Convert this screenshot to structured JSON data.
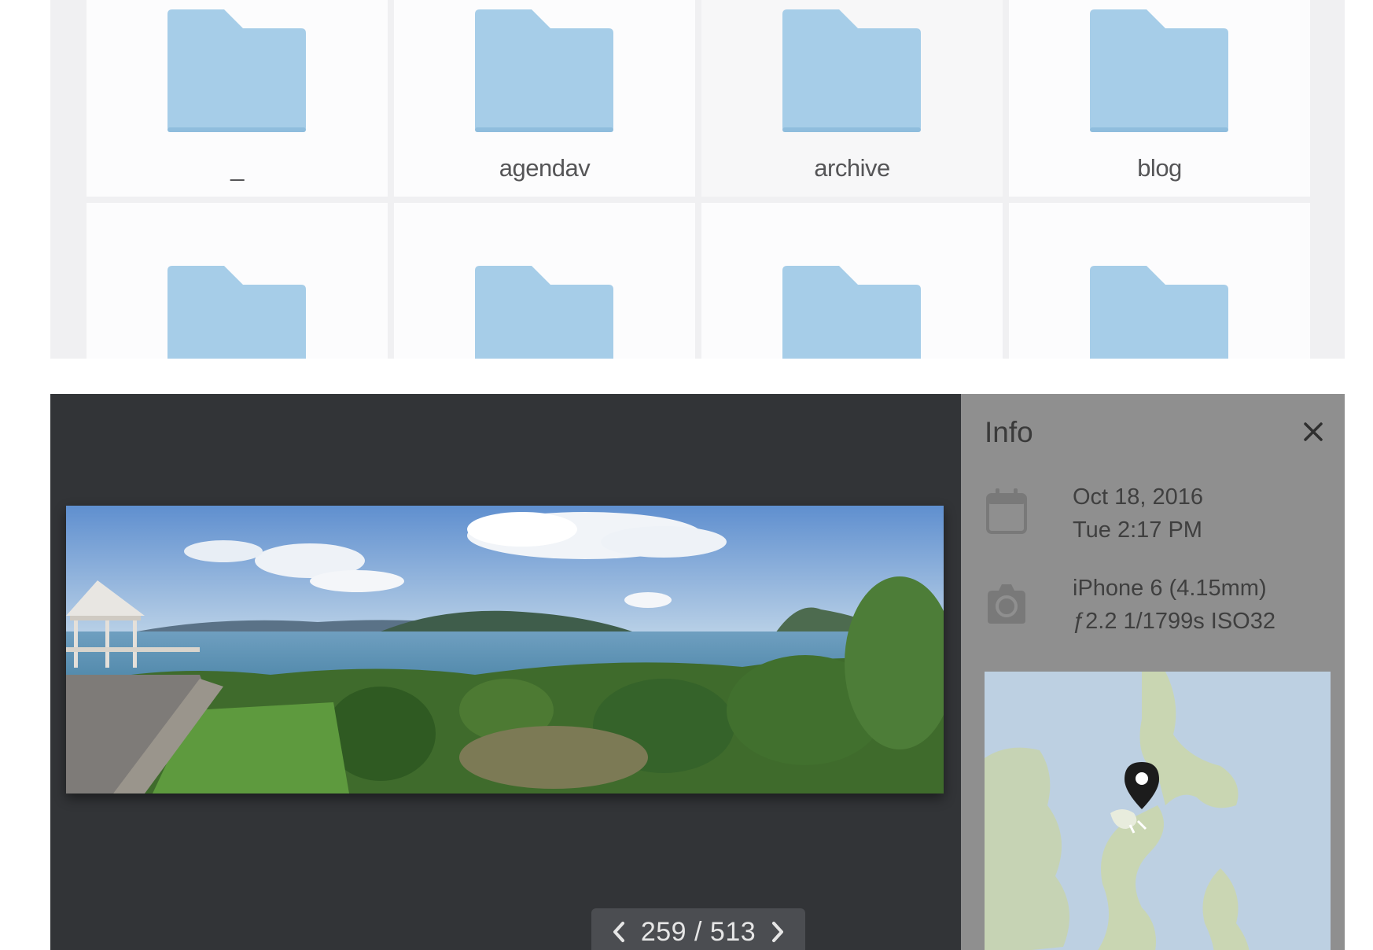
{
  "files": {
    "folders": [
      {
        "name": "_"
      },
      {
        "name": "agendav"
      },
      {
        "name": "archive"
      },
      {
        "name": "blog"
      }
    ],
    "folder_color": "#a6cde8"
  },
  "viewer": {
    "pager": {
      "counter": "259 / 513",
      "prev_icon": "chevron-left-icon",
      "next_icon": "chevron-right-icon"
    },
    "background_color": "#323437"
  },
  "info": {
    "title": "Info",
    "close_icon": "close-icon",
    "date": {
      "icon": "calendar-icon",
      "line1": "Oct 18, 2016",
      "line2": "Tue 2:17 PM"
    },
    "camera": {
      "icon": "camera-icon",
      "line1": "iPhone 6 (4.15mm)",
      "line2": "ƒ2.2 1/1799s ISO32"
    },
    "map": {
      "marker_icon": "map-marker-icon"
    },
    "panel_color": "#8f8f8f"
  }
}
